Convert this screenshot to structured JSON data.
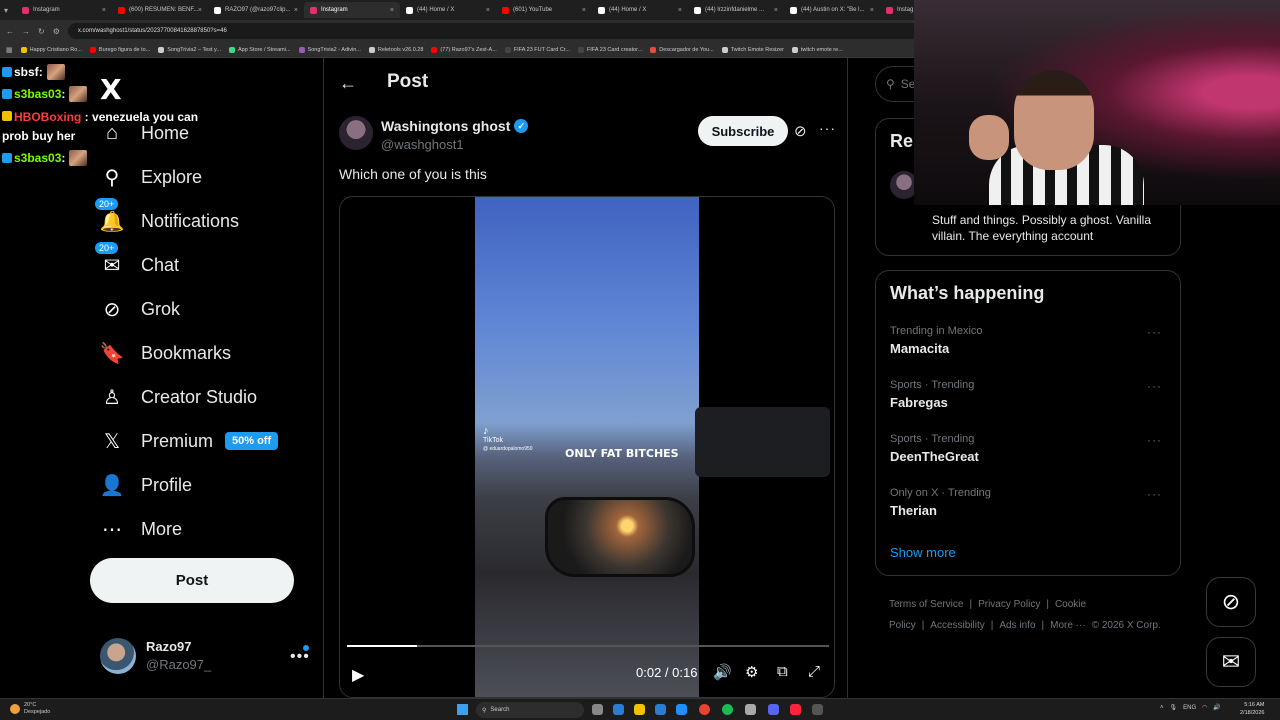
{
  "browser": {
    "tabs": [
      {
        "title": "Instagram",
        "color": "#e1306c",
        "active": false
      },
      {
        "title": "(600) RESUMEN: BENF...",
        "color": "#ff0000",
        "active": false
      },
      {
        "title": "RAZO97 (@razo97clip...",
        "color": "#ffffff",
        "active": false
      },
      {
        "title": "Instagram",
        "color": "#e1306c",
        "active": true
      },
      {
        "title": "(44) Home / X",
        "color": "#ffffff",
        "active": false
      },
      {
        "title": "(601) YouTube",
        "color": "#ff0000",
        "active": false
      },
      {
        "title": "(44) Home / X",
        "color": "#ffffff",
        "active": false
      },
      {
        "title": "(44) lrzzinfdanielme ...",
        "color": "#ffffff",
        "active": false
      },
      {
        "title": "(44) Austin on X: \"Be l...",
        "color": "#ffffff",
        "active": false
      },
      {
        "title": "Instag",
        "color": "#e1306c",
        "active": false
      }
    ],
    "url": "x.com/washghost1/status/2023770084162887850?s=46",
    "bookmarks": [
      {
        "title": "Happy Cristiano Ro...",
        "color": "#f2c200"
      },
      {
        "title": "Burego figura de to...",
        "color": "#ff0000"
      },
      {
        "title": "SongTrivia2 – Test y...",
        "color": "#cccccc"
      },
      {
        "title": "App Store / Streami...",
        "color": "#3ddc84"
      },
      {
        "title": "SongTrivia2 - Adivin...",
        "color": "#9b59b6"
      },
      {
        "title": "Reletools v26.0.28",
        "color": "#cccccc"
      },
      {
        "title": "(77) Razo97's Zest-A...",
        "color": "#ff0000"
      },
      {
        "title": "FIFA 23 FUT Card Cr...",
        "color": "#444444"
      },
      {
        "title": "FIFA 23 Card creator...",
        "color": "#444444"
      },
      {
        "title": "Descargador de You...",
        "color": "#e74c3c"
      },
      {
        "title": "Twitch Emote Resizer",
        "color": "#cccccc"
      },
      {
        "title": "twitch emote re...",
        "color": "#cccccc"
      }
    ]
  },
  "chat": [
    {
      "user": "sbsf",
      "color": "#ffffff",
      "text": ""
    },
    {
      "user": "s3bas03",
      "color": "#7cfc00",
      "text": ""
    },
    {
      "user": "HBOBoxing",
      "color": "#ff3b3b",
      "text": "venezuela you can prob buy her"
    },
    {
      "user": "s3bas03",
      "color": "#7cfc00",
      "text": ""
    }
  ],
  "nav": {
    "logo": "X",
    "items": [
      {
        "label": "Home",
        "icon": "home-icon",
        "glyph": "⌂",
        "badge": ""
      },
      {
        "label": "Explore",
        "icon": "search-icon",
        "glyph": "⚲",
        "badge": ""
      },
      {
        "label": "Notifications",
        "icon": "bell-icon",
        "glyph": "🔔",
        "badge": "20+"
      },
      {
        "label": "Chat",
        "icon": "mail-icon",
        "glyph": "✉",
        "badge": "20+"
      },
      {
        "label": "Grok",
        "icon": "grok-icon",
        "glyph": "⊘",
        "badge": ""
      },
      {
        "label": "Bookmarks",
        "icon": "bookmark-icon",
        "glyph": "🔖",
        "badge": ""
      },
      {
        "label": "Creator Studio",
        "icon": "creator-studio-icon",
        "glyph": "♙",
        "badge": ""
      },
      {
        "label": "Premium",
        "icon": "x-premium-icon",
        "glyph": "𝕏",
        "badge": "",
        "promo": "50% off"
      },
      {
        "label": "Profile",
        "icon": "person-icon",
        "glyph": "👤",
        "badge": ""
      },
      {
        "label": "More",
        "icon": "more-circle-icon",
        "glyph": "⋯",
        "badge": ""
      }
    ],
    "post_button": "Post",
    "account": {
      "name": "Razo97",
      "handle": "@Razo97_"
    }
  },
  "post": {
    "header": "Post",
    "author_name": "Washingtons ghost",
    "author_handle": "@washghost1",
    "subscribe": "Subscribe",
    "text": "Which one of you is this",
    "video": {
      "watermark_brand": "TikTok",
      "watermark_user": "@ eduardopalomo950",
      "truck_text": "ONLY FAT BITCHES",
      "current_time": "0:02",
      "duration": "0:16",
      "time_display": "0:02 / 0:16",
      "progress": 0.145
    }
  },
  "right": {
    "search_placeholder": "Se",
    "relevant_heading": "Rel",
    "relevant_bio": "Stuff and things. Possibly a ghost. Vanilla villain. The everything account",
    "happening_title": "What’s happening",
    "trends": [
      {
        "meta": "Trending in Mexico",
        "name": "Mamacita"
      },
      {
        "meta": "Sports · Trending",
        "name": "Fabregas"
      },
      {
        "meta": "Sports · Trending",
        "name": "DeenTheGreat"
      },
      {
        "meta": "Only on X · Trending",
        "name": "Therian"
      }
    ],
    "show_more": "Show more",
    "footer": [
      "Terms of Service",
      "|",
      "Privacy Policy",
      "|",
      "Cookie Policy",
      "|",
      "Accessibility",
      "|",
      "Ads info",
      "|",
      "More ···",
      "© 2026 X Corp."
    ]
  },
  "taskbar": {
    "temp": "20°C",
    "weather": "Despejado",
    "search": "Search",
    "lang": "ENG",
    "time": "5:16 AM",
    "date": "2/18/2026"
  }
}
